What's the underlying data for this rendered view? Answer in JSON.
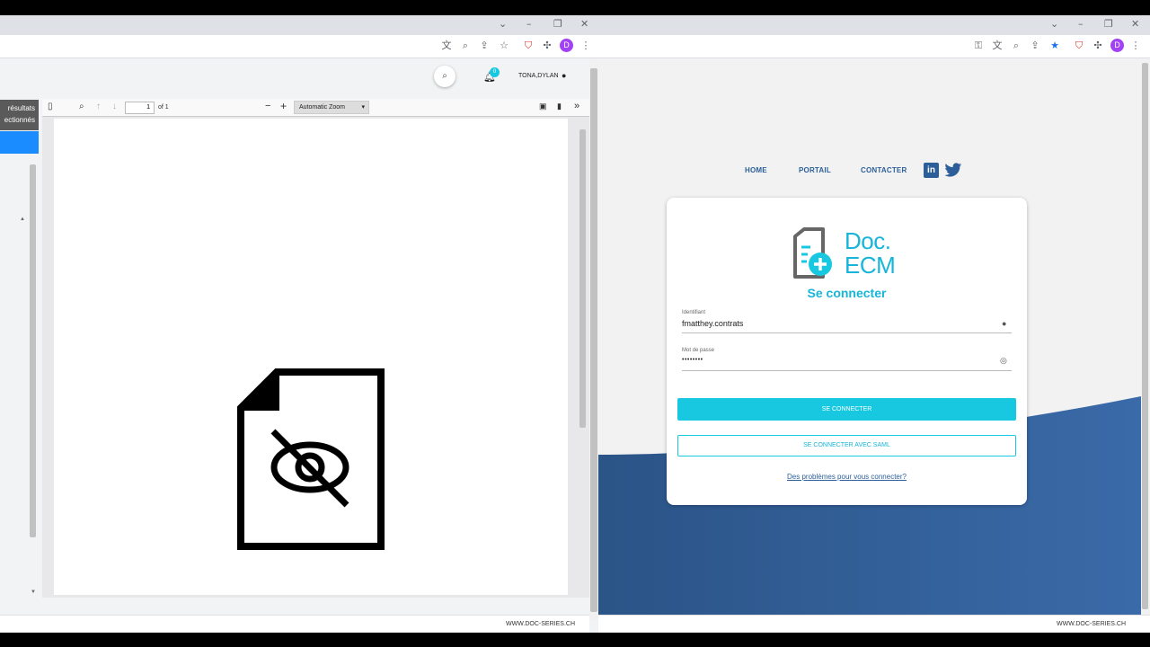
{
  "left_window": {
    "header": {
      "notification_count": "0",
      "user_name": "TONA,DYLAN"
    },
    "sidebar": {
      "results_line1": "résultats",
      "results_line2": "ectionnés"
    },
    "pdf_viewer": {
      "page_number": "1",
      "page_count": "of 1",
      "zoom_option": "Automatic Zoom"
    },
    "footer": "WWW.DOC-SERIES.CH"
  },
  "right_window": {
    "nav": {
      "home": "HOME",
      "portail": "PORTAIL",
      "contacter": "CONTACTER"
    },
    "logo": {
      "line1": "Doc.",
      "line2": "ECM"
    },
    "login": {
      "title": "Se connecter",
      "identifiant_label": "Identifiant",
      "identifiant_value": "fmatthey.contrats",
      "password_label": "Mot de passe",
      "password_value": "••••••••",
      "submit_label": "SE CONNECTER",
      "saml_label": "SE CONNECTER AVEC SAML",
      "help_link": "Des problèmes pour vous connecter?"
    },
    "footer": "WWW.DOC-SERIES.CH"
  },
  "colors": {
    "accent_cyan": "#17c8e0",
    "brand_blue": "#2c5f99",
    "wave_blue": "#3464a0",
    "sidebar_active": "#1a8cff"
  }
}
